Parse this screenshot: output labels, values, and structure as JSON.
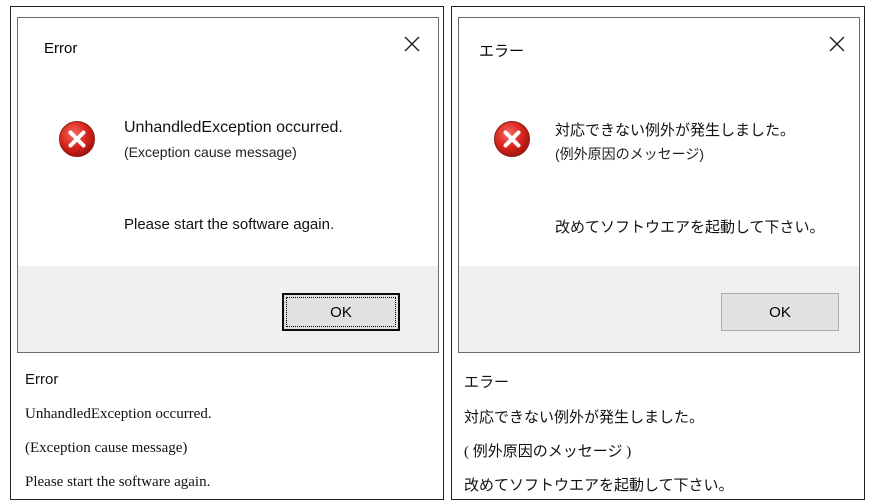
{
  "english": {
    "dialog": {
      "title": "Error",
      "close_icon": "close-icon",
      "icon": "error-circle-icon",
      "heading": "UnhandledException occurred.",
      "cause": "(Exception cause message)",
      "instruction": "Please start the software again.",
      "ok_label": "OK"
    },
    "caption": {
      "title": "Error",
      "line1": "UnhandledException occurred.",
      "line2": "(Exception cause message)",
      "line3": "Please start the software again."
    }
  },
  "japanese": {
    "dialog": {
      "title": "エラー",
      "close_icon": "close-icon",
      "icon": "error-circle-icon",
      "heading": "対応できない例外が発生しました。",
      "cause": "(例外原因のメッセージ)",
      "instruction": "改めてソフトウエアを起動して下さい。",
      "ok_label": "OK"
    },
    "caption": {
      "title": "エラー",
      "line1": "対応できない例外が発生しました。",
      "line2": "( 例外原因のメッセージ )",
      "line3": "改めてソフトウエアを起動して下さい。"
    }
  },
  "colors": {
    "error_red": "#d9251d",
    "footer_bg": "#f0f0f0",
    "button_bg": "#e1e1e1"
  }
}
